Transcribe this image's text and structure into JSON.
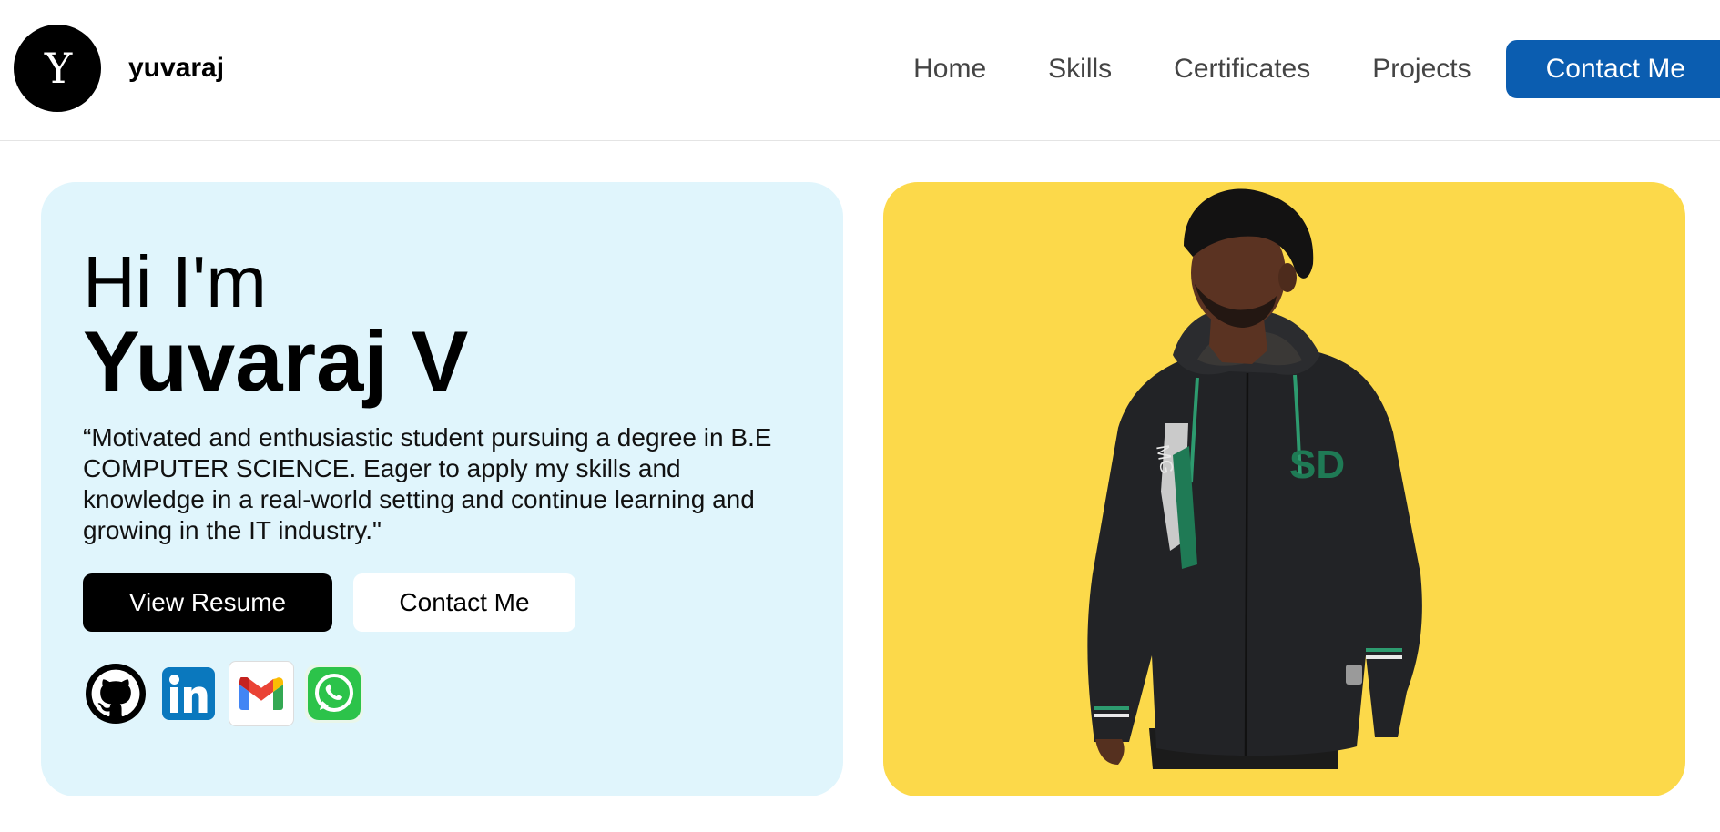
{
  "header": {
    "logo_letter": "Y",
    "brand": "yuvaraj",
    "nav": [
      {
        "label": "Home"
      },
      {
        "label": "Skills"
      },
      {
        "label": "Certificates"
      },
      {
        "label": "Projects"
      }
    ],
    "cta_label": "Contact Me"
  },
  "intro": {
    "greeting": "Hi I'm",
    "name": "Yuvaraj V",
    "bio": "“Motivated and enthusiastic student pursuing a degree in B.E COMPUTER SCIENCE. Eager to apply my skills and knowledge in a real-world setting and continue learning and growing in the IT industry.\"",
    "resume_label": "View Resume",
    "contact_label": "Contact Me",
    "socials": [
      {
        "icon": "github-icon"
      },
      {
        "icon": "linkedin-icon"
      },
      {
        "icon": "gmail-icon"
      },
      {
        "icon": "whatsapp-icon"
      }
    ]
  },
  "photo": {
    "background_color": "#fcd94a",
    "hoodie_print_left": "MG",
    "hoodie_print_right": "SD"
  },
  "colors": {
    "accent": "#0b5db0",
    "intro_bg": "#e0f5fc",
    "photo_bg": "#fcd94a"
  }
}
